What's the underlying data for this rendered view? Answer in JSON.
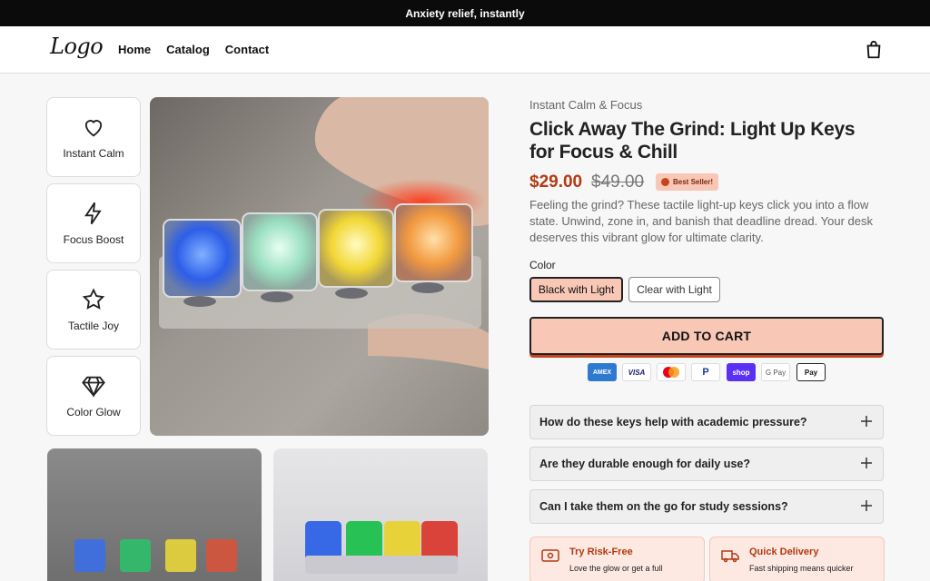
{
  "announcement": "Anxiety relief, instantly",
  "header": {
    "logo": "Logo",
    "nav": [
      "Home",
      "Catalog",
      "Contact"
    ],
    "cart_icon": "shopping-bag-icon"
  },
  "features": [
    {
      "label": "Instant Calm",
      "icon": "heart-icon"
    },
    {
      "label": "Focus Boost",
      "icon": "lightning-icon"
    },
    {
      "label": "Tactile Joy",
      "icon": "star-icon"
    },
    {
      "label": "Color Glow",
      "icon": "diamond-icon"
    }
  ],
  "product": {
    "kicker": "Instant Calm & Focus",
    "title": "Click Away The Grind: Light Up Keys for Focus & Chill",
    "price": "$29.00",
    "compare_price": "$49.00",
    "badge": "Best Seller!",
    "description": "Feeling the grind? These tactile light-up keys click you into a flow state. Unwind, zone in, and banish that deadline dread. Your desk deserves this vibrant glow for ultimate clarity.",
    "color_label": "Color",
    "color_options": [
      "Black with Light",
      "Clear with Light"
    ],
    "selected_color": "Black with Light",
    "add_to_cart": "ADD TO CART"
  },
  "payments": [
    "AMEX",
    "VISA",
    "Mastercard",
    "P",
    "shop",
    "G Pay",
    "Pay"
  ],
  "faqs": [
    "How do these keys help with academic pressure?",
    "Are they durable enough for daily use?",
    "Can I take them on the go for study sessions?"
  ],
  "trust": [
    {
      "title": "Try Risk-Free",
      "text": "Love the glow or get a full",
      "icon": "ticket-icon"
    },
    {
      "title": "Quick Delivery",
      "text": "Fast shipping means quicker",
      "icon": "truck-icon"
    }
  ],
  "colors": {
    "accent": "#b23a12",
    "peach": "#f8c7b6",
    "dark": "#0b0b0b"
  }
}
